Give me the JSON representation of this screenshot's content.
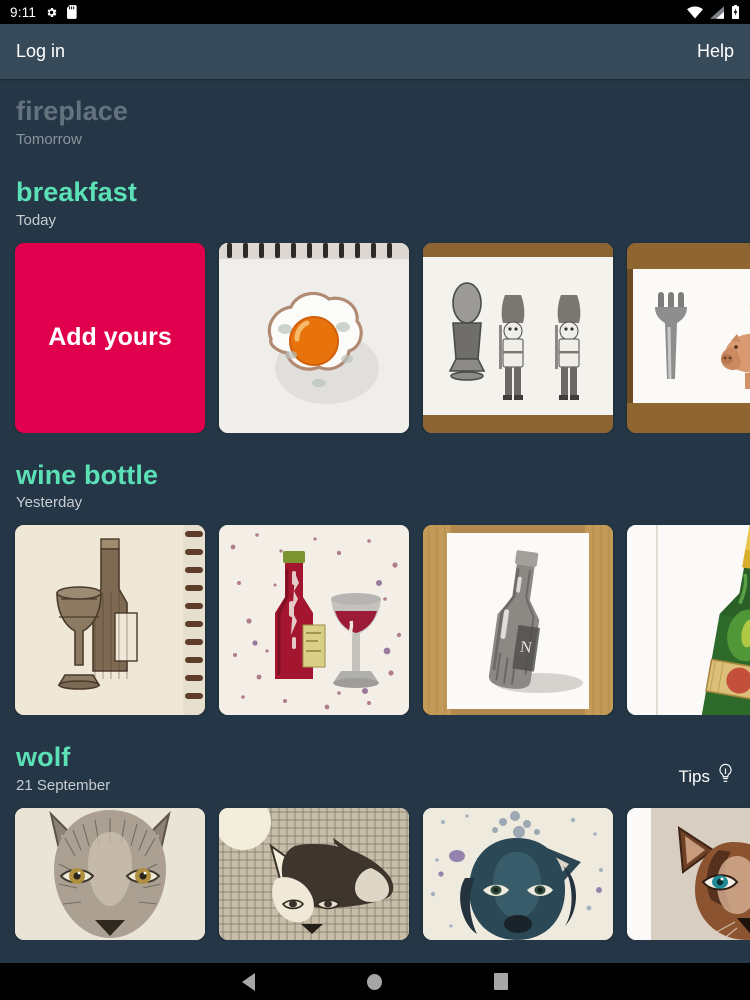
{
  "status_bar": {
    "time": "9:11",
    "left_icons": [
      "settings-gear-icon",
      "sd-card-icon"
    ],
    "right_icons": [
      "wifi-icon",
      "cellular-signal-icon",
      "battery-icon"
    ]
  },
  "app_bar": {
    "login_label": "Log in",
    "help_label": "Help"
  },
  "theme": {
    "background": "#253746",
    "appbar_background": "#374a5a",
    "accent_teal": "#5ce0b6",
    "muted_title": "#64727e",
    "add_button": "#e0004d",
    "text_primary": "#ffffff",
    "text_secondary": "#c6ccd2"
  },
  "sections": [
    {
      "title": "fireplace",
      "subtitle": "Tomorrow",
      "state": "upcoming",
      "tips_label": null,
      "items": []
    },
    {
      "title": "breakfast",
      "subtitle": "Today",
      "state": "active",
      "tips_label": null,
      "add_label": "Add yours",
      "items": [
        {
          "name": "add-yours-card",
          "alt": "Add yours"
        },
        {
          "name": "drawing-fried-egg",
          "alt": "Watercolour fried egg on spiral sketchbook page"
        },
        {
          "name": "drawing-egg-cup-guards",
          "alt": "Pencil drawing of boiled egg in egg cup with two royal guards"
        },
        {
          "name": "drawing-fork-pig-chicken",
          "alt": "Watercolour fork with chicken standing on a pig"
        }
      ]
    },
    {
      "title": "wine bottle",
      "subtitle": "Yesterday",
      "state": "active",
      "tips_label": null,
      "items": [
        {
          "name": "drawing-ink-bottle-glass",
          "alt": "Cross-hatched ink wine bottle and glass on cream sketchbook"
        },
        {
          "name": "drawing-watercolour-red-bottle",
          "alt": "Watercolour red wine bottle and glass with paint splatter"
        },
        {
          "name": "drawing-pencil-bottle",
          "alt": "Graphite pencil wine bottle on white paper over wooden desk"
        },
        {
          "name": "drawing-champagne-bottle",
          "alt": "Coloured champagne bottle with gold foil and red label"
        }
      ]
    },
    {
      "title": "wolf",
      "subtitle": "21 September",
      "state": "active",
      "tips_label": "Tips",
      "tips_icon": "lightbulb-icon",
      "items": [
        {
          "name": "drawing-pencil-wolf-face",
          "alt": "Detailed pencil drawing of a wolf face"
        },
        {
          "name": "drawing-ink-wolf-moon",
          "alt": "Cross-hatched ink wolf under a moon"
        },
        {
          "name": "drawing-watercolour-wolf",
          "alt": "Blue watercolour wolf with splatter"
        },
        {
          "name": "drawing-colour-wolf",
          "alt": "Coloured pencil wolf with teal eyes"
        }
      ]
    }
  ],
  "nav_bar": {
    "back": "back-button",
    "home": "home-button",
    "recents": "recents-button"
  }
}
